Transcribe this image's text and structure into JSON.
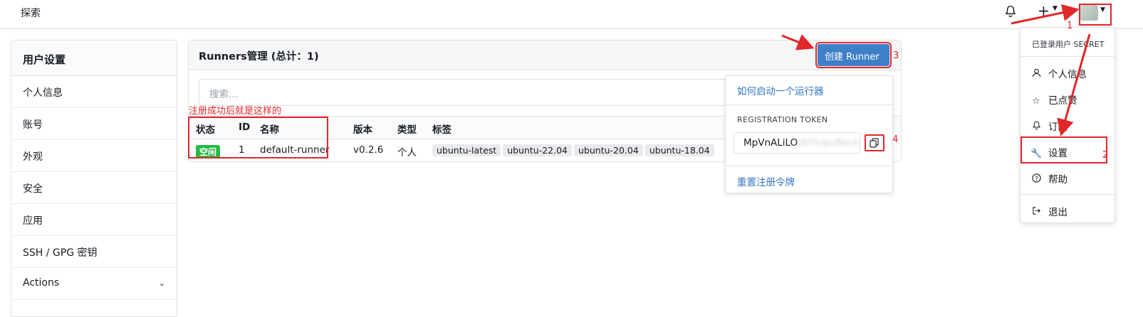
{
  "nav": {
    "explore": "探索",
    "plus": "+"
  },
  "sidebar": {
    "title": "用户设置",
    "items": [
      "个人信息",
      "账号",
      "外观",
      "安全",
      "应用",
      "SSH / GPG 密钥",
      "Actions"
    ]
  },
  "runners": {
    "title": "Runners管理 (总计：1)",
    "create_button": "创建 Runner",
    "search_placeholder": "搜索...",
    "columns": [
      "状态",
      "ID",
      "名称",
      "版本",
      "类型",
      "标签"
    ],
    "rows": [
      {
        "status": "空闲",
        "id": "1",
        "name": "default-runner",
        "version": "v0.2.6",
        "type": "个人",
        "labels": [
          "ubuntu-latest",
          "ubuntu-22.04",
          "ubuntu-20.04",
          "ubuntu-18.04"
        ]
      }
    ]
  },
  "create_dropdown": {
    "how_to": "如何启动一个运行器",
    "token_label": "REGISTRATION TOKEN",
    "token_visible": "MpVnALiLO",
    "token_hidden": "dVYcqu3bnX",
    "reset": "重置注册令牌"
  },
  "user_menu": {
    "header": "已登录用户 SECRET",
    "items": [
      {
        "label": "个人信息",
        "icon": "person-icon"
      },
      {
        "label": "已点赞",
        "icon": "star-icon"
      },
      {
        "label": "订阅",
        "icon": "bell-icon"
      },
      {
        "label": "设置",
        "icon": "wrench-icon"
      },
      {
        "label": "帮助",
        "icon": "question-icon"
      },
      {
        "label": "退出",
        "icon": "sign-out-icon"
      }
    ]
  },
  "annotations": {
    "note": "注册成功后就是这样的",
    "step1": "1",
    "step2": "2",
    "step3": "3",
    "step4": "4"
  },
  "colors": {
    "accent": "#3e7fc7",
    "annotation": "#e3262a",
    "idle": "#21ba45"
  }
}
